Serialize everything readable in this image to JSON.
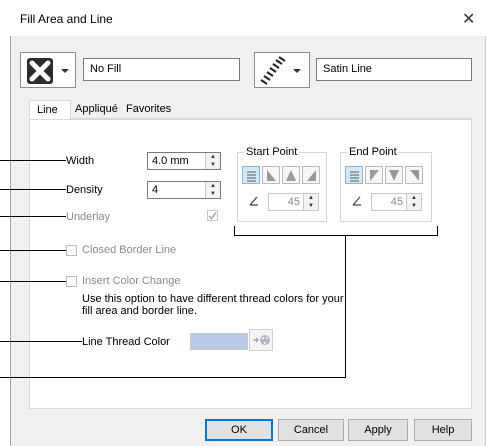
{
  "window": {
    "title": "Fill Area and Line",
    "close_glyph": "✕"
  },
  "fill": {
    "type_value": "No Fill",
    "icon": "no-fill-icon"
  },
  "line": {
    "type_value": "Satin Line",
    "icon": "satin-line-icon"
  },
  "tabs": [
    {
      "label": "Line"
    },
    {
      "label": "Appliqué"
    },
    {
      "label": "Favorites"
    }
  ],
  "settings": {
    "width_label": "Width",
    "width_value": "4.0 mm",
    "density_label": "Density",
    "density_value": "4",
    "underlay_label": "Underlay",
    "closed_border_label": "Closed Border Line",
    "insert_color_label": "Insert Color Change",
    "help_text": "Use this option to have different thread colors for your fill area and border line.",
    "thread_color_label": "Line Thread Color",
    "thread_color_swatch": "#b9cbe8"
  },
  "start_point": {
    "label": "Start Point",
    "angle": "45"
  },
  "end_point": {
    "label": "End Point",
    "angle": "45"
  },
  "buttons": {
    "ok": "OK",
    "cancel": "Cancel",
    "apply": "Apply",
    "help": "Help"
  },
  "colors": {
    "accent": "#0078d7",
    "selected": "#d4e9f7"
  }
}
